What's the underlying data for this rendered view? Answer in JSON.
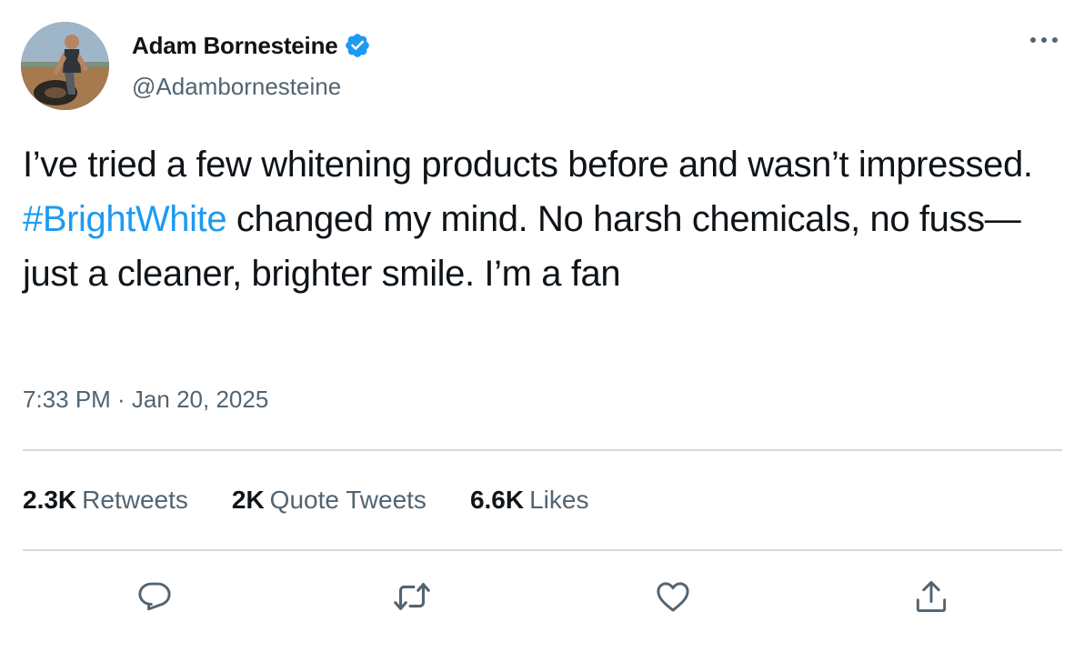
{
  "author": {
    "display_name": "Adam Bornesteine",
    "handle": "@Adambornesteine",
    "verified": true
  },
  "tweet": {
    "text_before": "I’ve tried a few whitening products before and wasn’t impressed. ",
    "hashtag": "#BrightWhite",
    "text_after": " changed my mind. No harsh chemicals, no fuss—just a cleaner, brighter smile. I’m a fan",
    "timestamp": "7:33 PM · Jan 20, 2025"
  },
  "stats": {
    "retweets_count": "2.3K",
    "retweets_label": "Retweets",
    "quote_tweets_count": "2K",
    "quote_tweets_label": "Quote Tweets",
    "likes_count": "6.6K",
    "likes_label": "Likes"
  },
  "icons": {
    "more": "more-horizontal-icon",
    "verified": "verified-badge-icon",
    "reply": "reply-icon",
    "retweet": "retweet-icon",
    "like": "heart-icon",
    "share": "share-icon"
  },
  "colors": {
    "link": "#1d9bf0",
    "text": "#0f1419",
    "secondary": "#536471",
    "divider": "#cfd9de"
  }
}
